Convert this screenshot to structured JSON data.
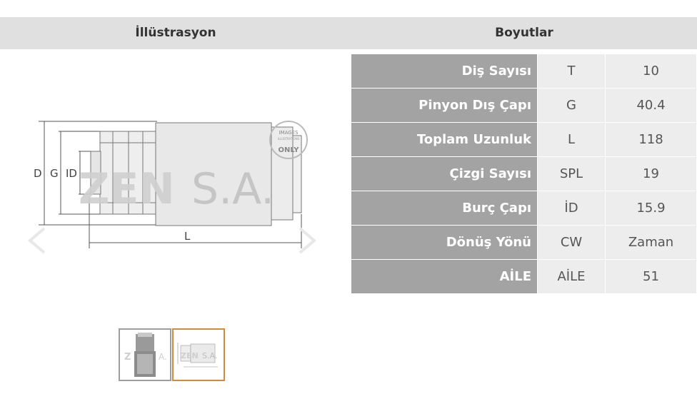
{
  "header": {
    "illustration_label": "İllüstrasyon",
    "dimensions_label": "Boyutlar"
  },
  "illustration": {
    "dim_labels": [
      "D",
      "G",
      "ID"
    ],
    "length_label": "L",
    "watermark_brand": "ZEN",
    "watermark_suffix": "S.A.",
    "stamp_top": "IMAGES",
    "stamp_sub": "ILLUSTRATIONS",
    "stamp_main": "ONLY"
  },
  "thumbnails": [
    {
      "name": "product-photo"
    },
    {
      "name": "technical-drawing",
      "selected": true
    }
  ],
  "specs": [
    {
      "label": "Diş Sayısı",
      "symbol": "T",
      "value": "10"
    },
    {
      "label": "Pinyon Dış Çapı",
      "symbol": "G",
      "value": "40.4"
    },
    {
      "label": "Toplam Uzunluk",
      "symbol": "L",
      "value": "118"
    },
    {
      "label": "Çizgi Sayısı",
      "symbol": "SPL",
      "value": "19"
    },
    {
      "label": "Burç Çapı",
      "symbol": "İD",
      "value": "15.9"
    },
    {
      "label": "Dönüş Yönü",
      "symbol": "CW",
      "value": "Zaman"
    },
    {
      "label": "AİLE",
      "symbol": "AİLE",
      "value": "51"
    }
  ],
  "colors": {
    "header_bg": "#e0e0e0",
    "label_bg": "#a3a3a3",
    "value_bg": "#ededed",
    "thumb_selected_border": "#d08a3c"
  }
}
